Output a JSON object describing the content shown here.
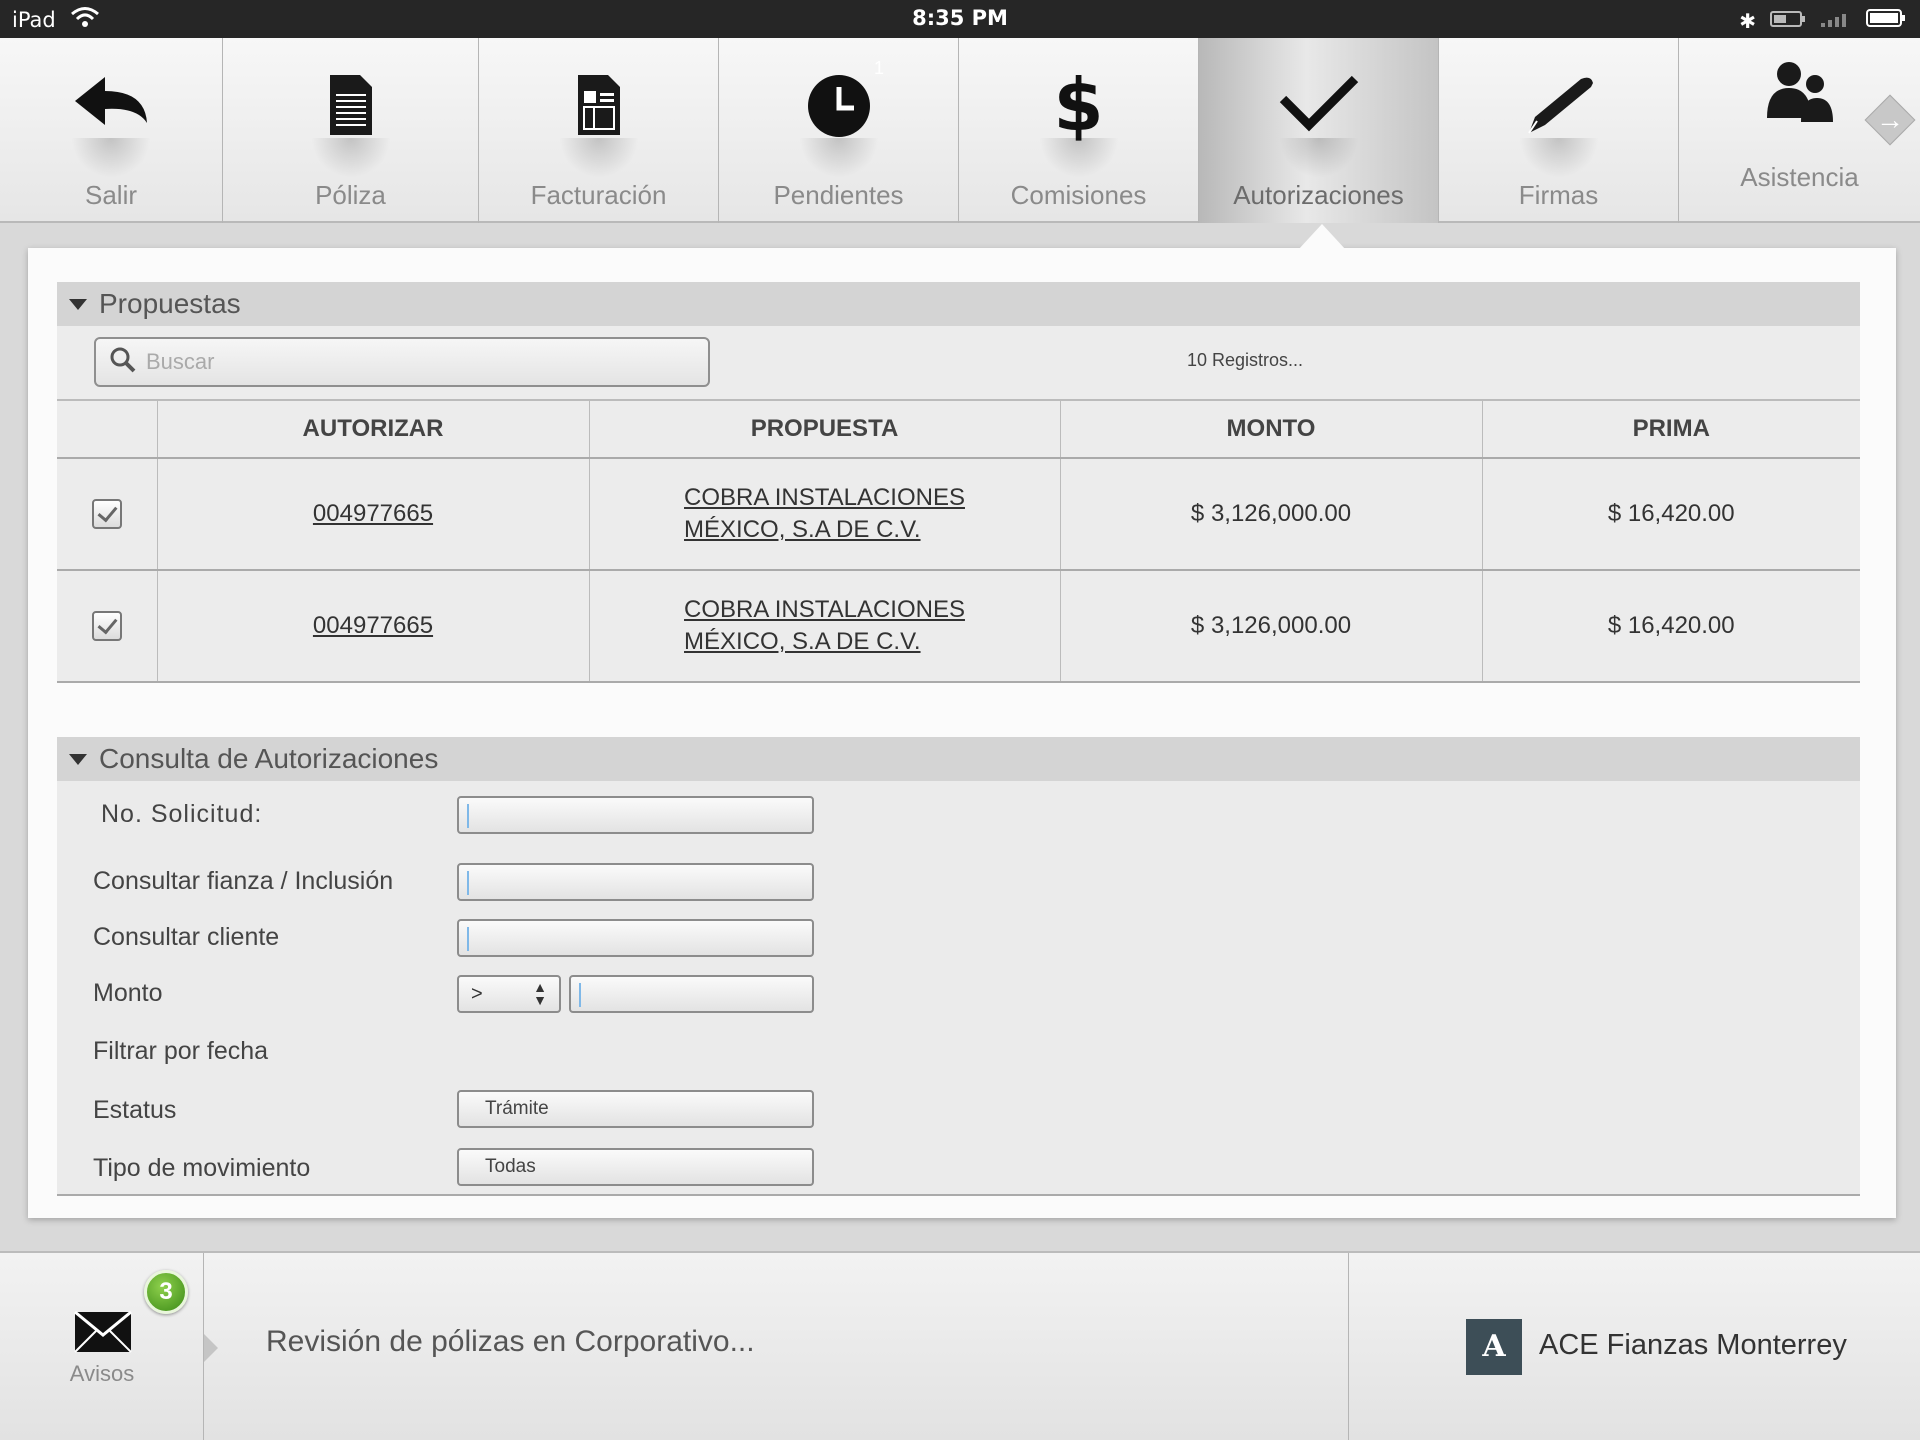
{
  "status_bar": {
    "device": "iPad",
    "time": "8:35 PM"
  },
  "toolbar": {
    "items": [
      {
        "label": "Salir",
        "icon": "back-arrow-icon"
      },
      {
        "label": "Póliza",
        "icon": "document-icon"
      },
      {
        "label": "Facturación",
        "icon": "invoice-icon"
      },
      {
        "label": "Pendientes",
        "icon": "clock-icon",
        "badge": "1"
      },
      {
        "label": "Comisiones",
        "icon": "dollar-icon"
      },
      {
        "label": "Autorizaciones",
        "icon": "checkmark-icon",
        "active": true
      },
      {
        "label": "Firmas",
        "icon": "pen-icon"
      },
      {
        "label": "Asistencia",
        "icon": "people-icon"
      }
    ],
    "next_icon": "arrow-right-icon"
  },
  "propuestas": {
    "title": "Propuestas",
    "search_placeholder": "Buscar",
    "count_text": "10 Registros...",
    "columns": [
      "",
      "AUTORIZAR",
      "PROPUESTA",
      "MONTO",
      "PRIMA"
    ],
    "rows": [
      {
        "checked": true,
        "autorizar": "004977665",
        "propuesta_line1": "COBRA INSTALACIONES",
        "propuesta_line2": "MÉXICO, S.A DE C.V.",
        "monto": "$ 3,126,000.00",
        "prima": "$ 16,420.00"
      },
      {
        "checked": true,
        "autorizar": "004977665",
        "propuesta_line1": "COBRA INSTALACIONES",
        "propuesta_line2": "MÉXICO, S.A DE C.V.",
        "monto": "$ 3,126,000.00",
        "prima": "$ 16,420.00"
      }
    ]
  },
  "consulta": {
    "title": "Consulta de Autorizaciones",
    "no_solicitud": "No. Solicitud:",
    "consultar_fianza": "Consultar fianza / Inclusión",
    "consultar_cliente": "Consultar cliente",
    "monto": "Monto",
    "monto_operator": ">",
    "filtrar_fecha": "Filtrar por fecha",
    "estatus": "Estatus",
    "estatus_value": "Trámite",
    "tipo_movimiento": "Tipo de movimiento",
    "tipo_movimiento_value": "Todas"
  },
  "bottom_bar": {
    "avisos_label": "Avisos",
    "avisos_badge": "3",
    "message": "Revisión de pólizas en Corporativo...",
    "brand_name": "ACE Fianzas Monterrey"
  },
  "colors": {
    "active_tab": "#c4c4c4",
    "badge_green": "#3b8a16",
    "brand_logo": "#3d4e57"
  }
}
